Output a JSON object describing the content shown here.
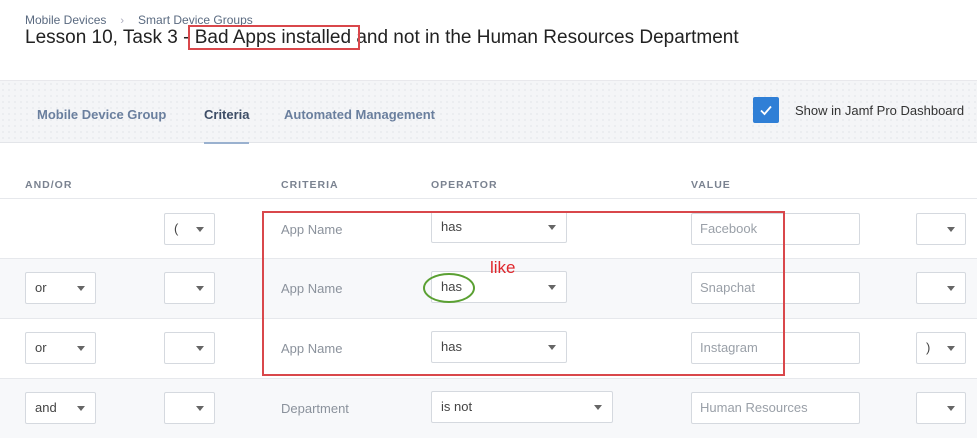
{
  "breadcrumb": {
    "items": [
      "Mobile Devices",
      "Smart Device Groups"
    ],
    "separator": "›"
  },
  "page": {
    "title_prefix": "Lesson 10, Task 3 - ",
    "title_highlight": "Bad Apps installed",
    "title_suffix": " and not in the Human Resources Department"
  },
  "tabs": [
    {
      "label": "Mobile Device Group",
      "active": false
    },
    {
      "label": "Criteria",
      "active": true
    },
    {
      "label": "Automated Management",
      "active": false
    }
  ],
  "dashboard": {
    "label": "Show in Jamf Pro Dashboard",
    "checked": true
  },
  "columns": {
    "andor": "AND/OR",
    "criteria": "CRITERIA",
    "operator": "OPERATOR",
    "value": "VALUE"
  },
  "rows": [
    {
      "andor": "",
      "open_paren": "(",
      "criteria": "App Name",
      "operator": "has",
      "value": "Facebook",
      "close_paren": ""
    },
    {
      "andor": "or",
      "open_paren": "",
      "criteria": "App Name",
      "operator": "has",
      "value": "Snapchat",
      "close_paren": ""
    },
    {
      "andor": "or",
      "open_paren": "",
      "criteria": "App Name",
      "operator": "has",
      "value": "Instagram",
      "close_paren": ")"
    },
    {
      "andor": "and",
      "open_paren": "",
      "criteria": "Department",
      "operator": "is not",
      "value": "Human Resources",
      "close_paren": ""
    }
  ],
  "annotations": {
    "note": "like",
    "colors": {
      "box": "#d9474b",
      "note": "#e0262b",
      "circle": "#5aa032"
    }
  },
  "colors": {
    "accent": "#2f7fd6",
    "tab_text": "#6a7f9e",
    "active_tab_underline": "#9ab1cf"
  }
}
